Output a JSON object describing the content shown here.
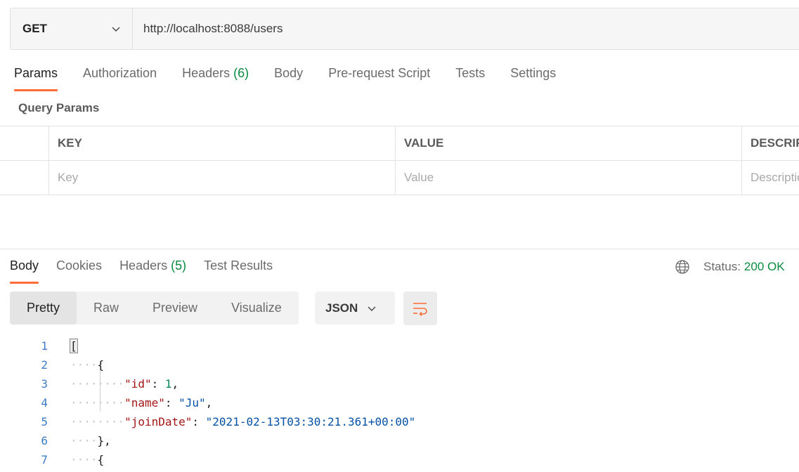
{
  "request": {
    "method": "GET",
    "url": "http://localhost:8088/users"
  },
  "request_tabs": {
    "params": "Params",
    "authorization": "Authorization",
    "headers": "Headers",
    "headers_count": "(6)",
    "body": "Body",
    "prerequest": "Pre-request Script",
    "tests": "Tests",
    "settings": "Settings"
  },
  "query_params": {
    "title": "Query Params",
    "columns": [
      "KEY",
      "VALUE",
      "DESCRIPTION"
    ],
    "placeholders": [
      "Key",
      "Value",
      "Description"
    ]
  },
  "response_tabs": {
    "body": "Body",
    "cookies": "Cookies",
    "headers": "Headers",
    "headers_count": "(5)",
    "test_results": "Test Results"
  },
  "status": {
    "label": "Status:",
    "value": "200 OK"
  },
  "format": {
    "pretty": "Pretty",
    "raw": "Raw",
    "preview": "Preview",
    "visualize": "Visualize",
    "language": "JSON"
  },
  "code_lines": {
    "n1": "1",
    "n2": "2",
    "n3": "3",
    "n4": "4",
    "n5": "5",
    "n6": "6",
    "n7": "7",
    "l1_bracket": "[",
    "l2_brace": "{",
    "l3_key": "\"id\"",
    "l3_val": "1",
    "l4_key": "\"name\"",
    "l4_val": "\"Ju\"",
    "l5_key": "\"joinDate\"",
    "l5_val": "\"2021-02-13T03:30:21.361+00:00\"",
    "l6_close": "},",
    "l7_brace": "{"
  },
  "colors": {
    "accent": "#ff6c37",
    "count_green": "#0a8a3f",
    "json_key": "#a31515",
    "json_number": "#098658",
    "json_string": "#0451a5"
  }
}
